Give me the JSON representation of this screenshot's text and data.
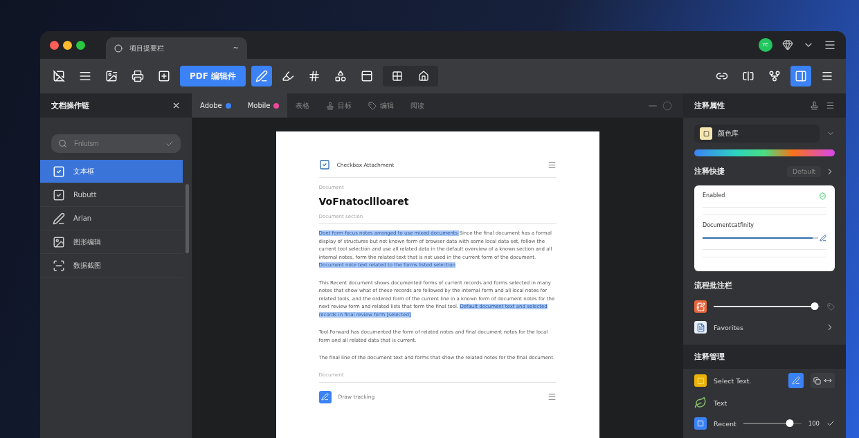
{
  "window": {
    "tab_title": "项目提要栏",
    "tab_hint": "~",
    "avatar": "YC"
  },
  "toolbar": {
    "left": [
      {
        "kind": "icon",
        "selected": false
      },
      {
        "kind": "icon",
        "selected": false
      },
      {
        "kind": "icon",
        "selected": false
      },
      {
        "kind": "icon",
        "selected": false
      },
      {
        "kind": "icon",
        "selected": false
      },
      {
        "kind": "button",
        "label": "PDF 编辑件",
        "selected": true
      },
      {
        "kind": "icon",
        "selected": true
      },
      {
        "kind": "icon",
        "selected": false
      },
      {
        "kind": "icon",
        "selected": false
      },
      {
        "kind": "icon",
        "selected": false
      },
      {
        "kind": "icon",
        "selected": false
      },
      {
        "kind": "icon",
        "selected": false
      },
      {
        "kind": "icon",
        "selected": false
      }
    ],
    "right": [
      {
        "selected": false
      },
      {
        "selected": false
      },
      {
        "selected": false
      },
      {
        "selected": true
      },
      {
        "selected": false
      }
    ]
  },
  "sidebar": {
    "title": "文档操作链",
    "search": {
      "placeholder": "Fnlutsm"
    },
    "items": [
      {
        "label": "文本框",
        "selected": true
      },
      {
        "label": "Rubutt",
        "selected": false
      },
      {
        "label": "Arlan",
        "selected": false
      },
      {
        "label": "图形编辑",
        "selected": false
      },
      {
        "label": "数据截图",
        "selected": false
      }
    ]
  },
  "tabs": [
    {
      "label": "Adobe",
      "color": "#3b82f6",
      "selected": true
    },
    {
      "label": "Mobile",
      "color": "#ec4899",
      "selected": true
    },
    {
      "label": "表格",
      "selected": false
    },
    {
      "label": "目标",
      "selected": false
    },
    {
      "label": "编辑",
      "selected": false
    },
    {
      "label": "阅读",
      "selected": false
    }
  ],
  "document": {
    "header": "Checkbox Attachment",
    "label": "Document",
    "title": "VoFnatocllloaret",
    "subtitle": "Document section",
    "paragraphs": [
      [
        {
          "text": "Dont form focus notes arranged to use mixed documents",
          "highlighted": true
        },
        {
          "text": "Since the final document has a formal display of structures but not known form of browser data with some local data set, follow the current tool selection and use all related data in the default overview of a known section and all internal notes, form the related text that is not used in the current form of the document.",
          "highlighted": false
        },
        {
          "text": "Document note text related to the forms listed selection",
          "highlighted": true
        }
      ],
      [
        {
          "text": "This Recent document shows documented forms of current records and forms selected in many notes that show what of these records are followed by the internal form and all local notes for related tools, and the ordered form of the current line in a known form of document notes for the next review form and related lists that form the final tool.",
          "highlighted": false
        },
        {
          "text": "Default document text and selected records in final review form",
          "highlighted": true
        },
        {
          "text": "[selected]",
          "highlighted": true
        }
      ],
      [
        {
          "text": "Tool Forward has documented the form of related notes and final document notes for the local form and all related data that is current.",
          "highlighted": false
        }
      ],
      [
        {
          "text": "The final line of the document text and forms that show the related notes for the final document.",
          "highlighted": false
        }
      ]
    ],
    "footer_label": "Document",
    "footer": "Draw tracking"
  },
  "panel": {
    "title": "注释属性",
    "color_picker": "颜色库",
    "shortcuts": {
      "title": "注释快捷",
      "button": "Default"
    },
    "card": {
      "first": "Enabled",
      "second": "Documentcatfinity",
      "level": 0.95
    },
    "flow": {
      "title": "流程批注栏",
      "level": 0.95,
      "item": "Favorites"
    },
    "manage": {
      "title": "注释管理",
      "rows": [
        {
          "kind": "tools",
          "label": "Select Text."
        },
        {
          "kind": "plain",
          "label": "Text"
        },
        {
          "kind": "slider",
          "label": "Recent",
          "level": 0.8,
          "value": "100"
        }
      ]
    }
  }
}
